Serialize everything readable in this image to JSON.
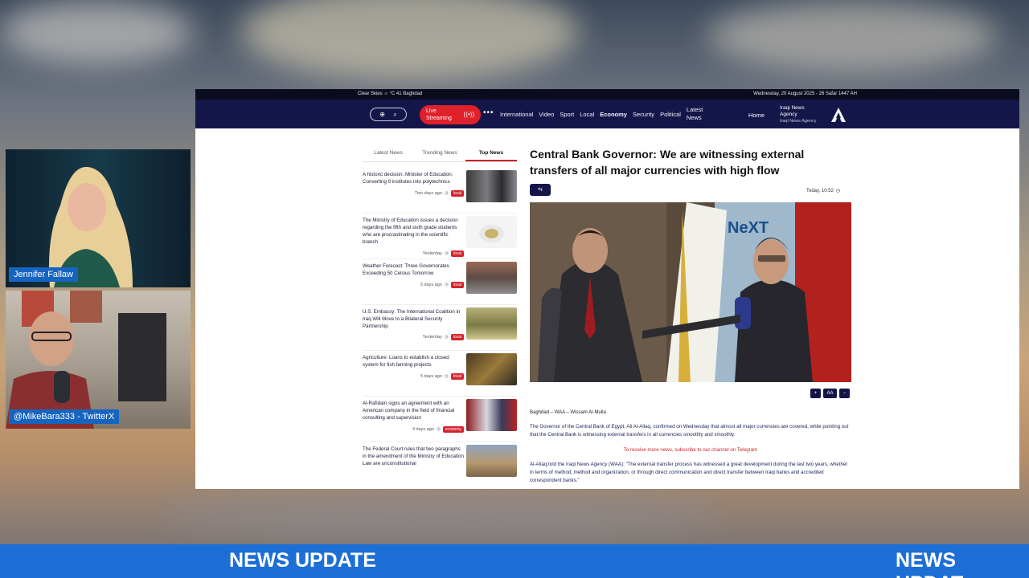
{
  "topbar": {
    "weather": "Clear Skies ☼ °C 41 Baghdad",
    "date": "Wednesday, 20 August 2025 - 26 Safar 1447 AH"
  },
  "navbar": {
    "live_label": "Live Streaming",
    "items": [
      "International",
      "Video",
      "Sport",
      "Local",
      "Economy",
      "Security",
      "Political"
    ],
    "latest_news": "Latest News",
    "home": "Home",
    "brand_line1": "Iraqi News",
    "brand_line2": "Agency",
    "brand_sub": "Iraqi News Agency"
  },
  "tabs": [
    "Latest News",
    "Trending News",
    "Top News"
  ],
  "news": [
    {
      "title": "A historic decision. Minister of Education: Converting 9 institutes into polytechnics",
      "time": "Two days ago",
      "tag": "local"
    },
    {
      "title": "The Ministry of Education issues a decision regarding the fifth and sixth grade students who are procrastinating in the scientific branch",
      "time": "Yesterday",
      "tag": "local"
    },
    {
      "title": "Weather Forecast: Three Governorates Exceeding 50 Celsius Tomorrow",
      "time": "5 days ago",
      "tag": "local"
    },
    {
      "title": "U.S. Embassy: The International Coalition in Iraq Will Move to a Bilateral Security Partnership",
      "time": "Yesterday",
      "tag": "local"
    },
    {
      "title": "Agriculture: Loans to establish a closed system for fish farming projects",
      "time": "5 days ago",
      "tag": "local"
    },
    {
      "title": "Al-Rafidain signs an agreement with an American company in the field of financial consulting and supervision",
      "time": "4 days ago",
      "tag": "economy"
    },
    {
      "title": "The Federal Court rules that two paragraphs in the amendment of the Ministry of Education Law are unconstitutional",
      "time": "",
      "tag": ""
    }
  ],
  "article": {
    "title": "Central Bank Governor: We are witnessing external transfers of all major currencies with high flow",
    "time": "Today, 10:52",
    "font_aa": "AA",
    "photo_sign": "NeXT",
    "byline": "Baghdad – WAA – Wissam Al-Mulla",
    "para1": "The Governor of the Central Bank of Egypt, Ali Al-Allaq, confirmed on Wednesday that almost all major currencies are covered, while pointing out that the Central Bank is witnessing external transfers in all currencies smoothly and smoothly.",
    "subscribe": "To receive more news, subscribe to our channel on Telegram",
    "para2": "Al-Allaq told the Iraqi News Agency (WAA): \"The external transfer process has witnessed a great development during the last two years, whether in terms of method, method and organization, or through direct communication and direct transfer between Iraqi banks and accredited correspondent banks.\""
  },
  "cams": {
    "top_label": "Jennifer Fallaw",
    "bottom_label": "@MikeBara333 - TwitterX"
  },
  "ticker": {
    "text1": "NEWS UPDATE",
    "text2": "NEWS UPDAT"
  }
}
